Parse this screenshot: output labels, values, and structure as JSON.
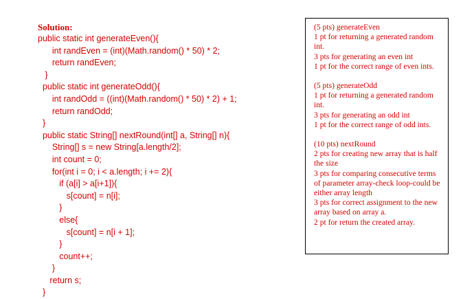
{
  "solution": {
    "heading": "Solution:",
    "code_lines": [
      "public static int generateEven(){",
      "      int randEven = (int)(Math.random() * 50) * 2;",
      "      return randEven;",
      "   }",
      "  public static int generateOdd(){",
      "      int randOdd = ((int)(Math.random() * 50) * 2) + 1;",
      "      return randOdd;",
      "  }",
      "  public static String[] nextRound(int[] a, String[] n){",
      "      String[] s = new String[a.length/2];",
      "      int count = 0;",
      "      for(int i = 0; i < a.length; i += 2){",
      "         if (a[i] > a[i+1]){",
      "            s[count] = n[i];",
      "         }",
      "         else{",
      "            s[count] = n[i + 1];",
      "         }",
      "         count++;",
      "      }",
      "     return s;",
      "  }"
    ]
  },
  "rubric": {
    "sections": [
      {
        "title": "(5 pts) generateEven",
        "items": [
          "1 pt for returning a generated random int.",
          "3 pts for generating an even int",
          "1 pt for the correct range of even ints."
        ]
      },
      {
        "title": "(5 pts) generateOdd",
        "items": [
          "1 pt for returning a generated random int.",
          "3 pts for generating an odd int",
          "1 pt for the correct range of odd ints."
        ]
      },
      {
        "title": "(10 pts) nextRound",
        "items": [
          "2 pts for creating  new array that is half the size",
          "3 pts for comparing consecutive terms of parameter array-check loop-could be either array length",
          "3 pts for correct assignment to the new array based on array a.",
          "2 pt for return the created array."
        ]
      }
    ]
  }
}
